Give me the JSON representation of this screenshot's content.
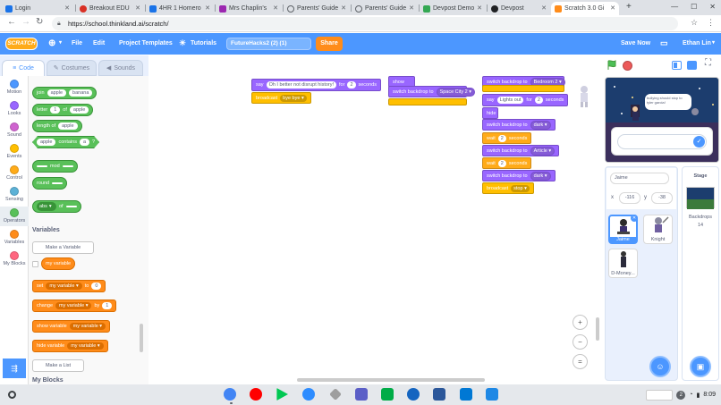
{
  "browser": {
    "tabs": [
      {
        "label": "Login",
        "color": "#1a73e8"
      },
      {
        "label": "Breakout EDU",
        "color": "#d93025"
      },
      {
        "label": "4HR 1 Homero",
        "color": "#1a73e8"
      },
      {
        "label": "Mrs Chaplin's",
        "color": "#9c27b0"
      },
      {
        "label": "Parents' Guide",
        "color": "#5f6368"
      },
      {
        "label": "Parents' Guide",
        "color": "#5f6368"
      },
      {
        "label": "Devpost Demo",
        "color": "#34a853"
      },
      {
        "label": "Devpost",
        "color": "#202124"
      },
      {
        "label": "Scratch 3.0 Gi",
        "color": "#ff8c1a"
      }
    ],
    "url": "https://school.thinkland.ai/scratch/"
  },
  "menu": {
    "logo": "SCRATCH",
    "file": "File",
    "edit": "Edit",
    "templates": "Project Templates",
    "tutorials": "Tutorials",
    "project_title": "FutureHacks2 (2) (1)",
    "share": "Share",
    "save_now": "Save Now",
    "user": "Ethan Lin"
  },
  "editor_tabs": {
    "code": "Code",
    "costumes": "Costumes",
    "sounds": "Sounds"
  },
  "categories": [
    {
      "label": "Motion",
      "color": "#4c97ff"
    },
    {
      "label": "Looks",
      "color": "#9966ff"
    },
    {
      "label": "Sound",
      "color": "#cf63cf"
    },
    {
      "label": "Events",
      "color": "#ffbf00"
    },
    {
      "label": "Control",
      "color": "#ffab19"
    },
    {
      "label": "Sensing",
      "color": "#5cb1d6"
    },
    {
      "label": "Operators",
      "color": "#59c059"
    },
    {
      "label": "Variables",
      "color": "#ff8c1a"
    },
    {
      "label": "My Blocks",
      "color": "#ff6680"
    }
  ],
  "palette": {
    "join": {
      "label": "join",
      "a": "apple",
      "b": "banana"
    },
    "letter": {
      "label": "letter",
      "n": "1",
      "of": "of",
      "s": "apple"
    },
    "length": {
      "label": "length of",
      "s": "apple"
    },
    "contains": {
      "s": "apple",
      "label": "contains",
      "c": "a",
      "q": "?"
    },
    "mod": "mod",
    "round": "round",
    "abs": {
      "fn": "abs",
      "of": "of"
    },
    "variables_heading": "Variables",
    "make_variable": "Make a Variable",
    "my_variable": "my variable",
    "set": {
      "label": "set",
      "var": "my variable",
      "to": "to",
      "val": "0"
    },
    "change": {
      "label": "change",
      "var": "my variable",
      "by": "by",
      "val": "1"
    },
    "show": {
      "label": "show variable",
      "var": "my variable"
    },
    "hide": {
      "label": "hide variable",
      "var": "my variable"
    },
    "make_list": "Make a List",
    "my_blocks_heading": "My Blocks"
  },
  "scripts": {
    "s1_say": "say",
    "s1_text": "Oh I better not disrupt history!",
    "s1_for": "for",
    "s1_secs": "2",
    "s1_seconds": "seconds",
    "s1_broadcast": "broadcast",
    "s1_msg": "bye bye",
    "s2_show": "show",
    "s2_switch": "switch backdrop to",
    "s2_backdrop": "Space City 2",
    "s3_switch": "switch backdrop to",
    "s3_bd1": "Bedroom 2",
    "s3_say": "say",
    "s3_text": "Lights out",
    "s3_for": "for",
    "s3_secs": "2",
    "s3_seconds": "seconds",
    "s3_hide": "hide",
    "s3_bd2": "dark",
    "s3_wait": "wait",
    "s3_w1": "2",
    "s3_bd3": "Article",
    "s3_w2": "2",
    "s3_bd4": "dark",
    "s3_broadcast": "broadcast",
    "s3_msg": "stop"
  },
  "zoom": {
    "in": "+",
    "out": "−",
    "reset": "="
  },
  "stage": {
    "bubble": "bullying should stop to tyler garcia!"
  },
  "sprite_info": {
    "name": "Jaime",
    "x_label": "x",
    "x": "-116",
    "y_label": "y",
    "y": "-38"
  },
  "sprites": [
    {
      "name": "Jaime",
      "selected": true
    },
    {
      "name": "Knight",
      "selected": false
    },
    {
      "name": "D-Money...",
      "selected": false
    }
  ],
  "stage_panel": {
    "title": "Stage",
    "backdrops_label": "Backdrops",
    "backdrops_count": "14"
  },
  "taskbar": {
    "time": "8:09",
    "notif": "2",
    "apps": [
      {
        "name": "chrome",
        "color": "#4285f4"
      },
      {
        "name": "youtube",
        "color": "#ff0000"
      },
      {
        "name": "play-store",
        "color": "#00c853"
      },
      {
        "name": "zoom",
        "color": "#2d8cff"
      },
      {
        "name": "screencastify",
        "color": "#9e9e9e"
      },
      {
        "name": "teams",
        "color": "#5b5fc7"
      },
      {
        "name": "meet",
        "color": "#00ac47"
      },
      {
        "name": "webcam",
        "color": "#1565c0"
      },
      {
        "name": "word",
        "color": "#2b579a"
      },
      {
        "name": "outlook",
        "color": "#0078d4"
      },
      {
        "name": "files",
        "color": "#1e88e5"
      }
    ]
  }
}
